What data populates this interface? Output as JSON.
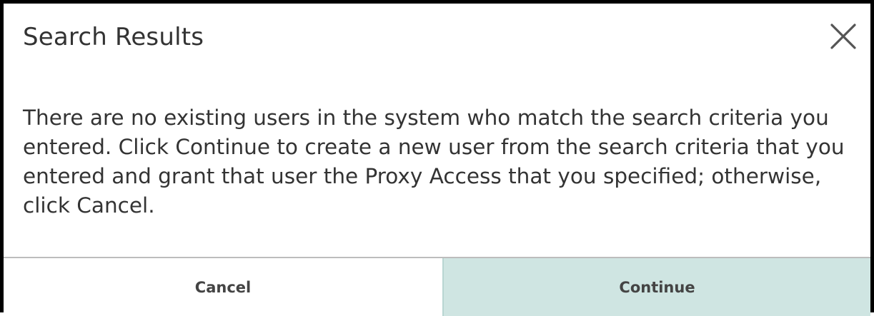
{
  "dialog": {
    "title": "Search Results",
    "close_icon": "close-icon",
    "message": "There are no existing users in the system who match the search criteria you entered. Click Continue to create a new user from the search criteria that you entered and grant that user the Proxy Access that you specified; otherwise, click Cancel.",
    "buttons": {
      "cancel_label": "Cancel",
      "continue_label": "Continue"
    }
  },
  "colors": {
    "continue_background": "#cfe5e2",
    "frame": "#000000",
    "text": "#333333"
  }
}
